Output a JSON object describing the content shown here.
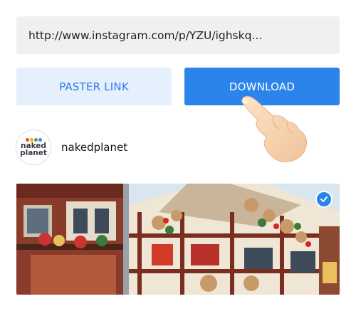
{
  "url_field": {
    "value": "http://www.instagram.com/p/YZU/ighskq..."
  },
  "buttons": {
    "paste_label": "PASTER LINK",
    "download_label": "DOWNLOAD"
  },
  "profile": {
    "username": "nakedplanet",
    "avatar_line1": "naked",
    "avatar_line2": "planet"
  },
  "colors": {
    "accent": "#2b84ea",
    "paste_bg": "#e6f0fc",
    "field_bg": "#f0f0f0"
  },
  "icons": {
    "selected": "check-circle-icon",
    "gesture": "pointing-hand-icon"
  },
  "photo": {
    "selected": true
  }
}
